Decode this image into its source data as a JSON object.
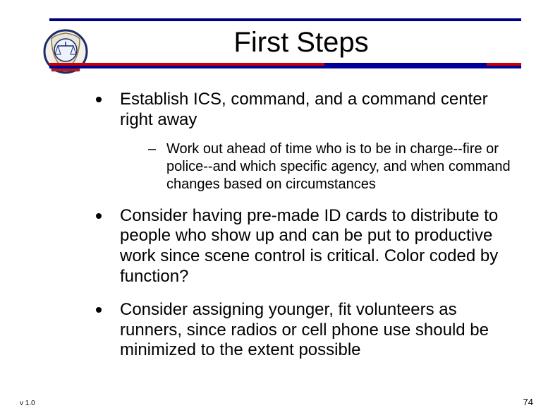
{
  "title": "First Steps",
  "bullets": [
    {
      "text": "Establish ICS, command, and a command center right away",
      "sub": [
        "Work out ahead of time who is to be in charge--fire or police--and which specific agency, and when command changes based on circumstances"
      ]
    },
    {
      "text": "Consider having pre-made ID cards to distribute to people who show up and can be put to productive work since scene control is critical.  Color coded by function?",
      "sub": []
    },
    {
      "text": "Consider assigning younger, fit volunteers as runners, since radios or cell phone use should be minimized to the extent possible",
      "sub": []
    }
  ],
  "footer": {
    "version": "v 1.0",
    "page": "74"
  },
  "colors": {
    "rule_blue": "#000099",
    "rule_red": "#cc0000"
  }
}
